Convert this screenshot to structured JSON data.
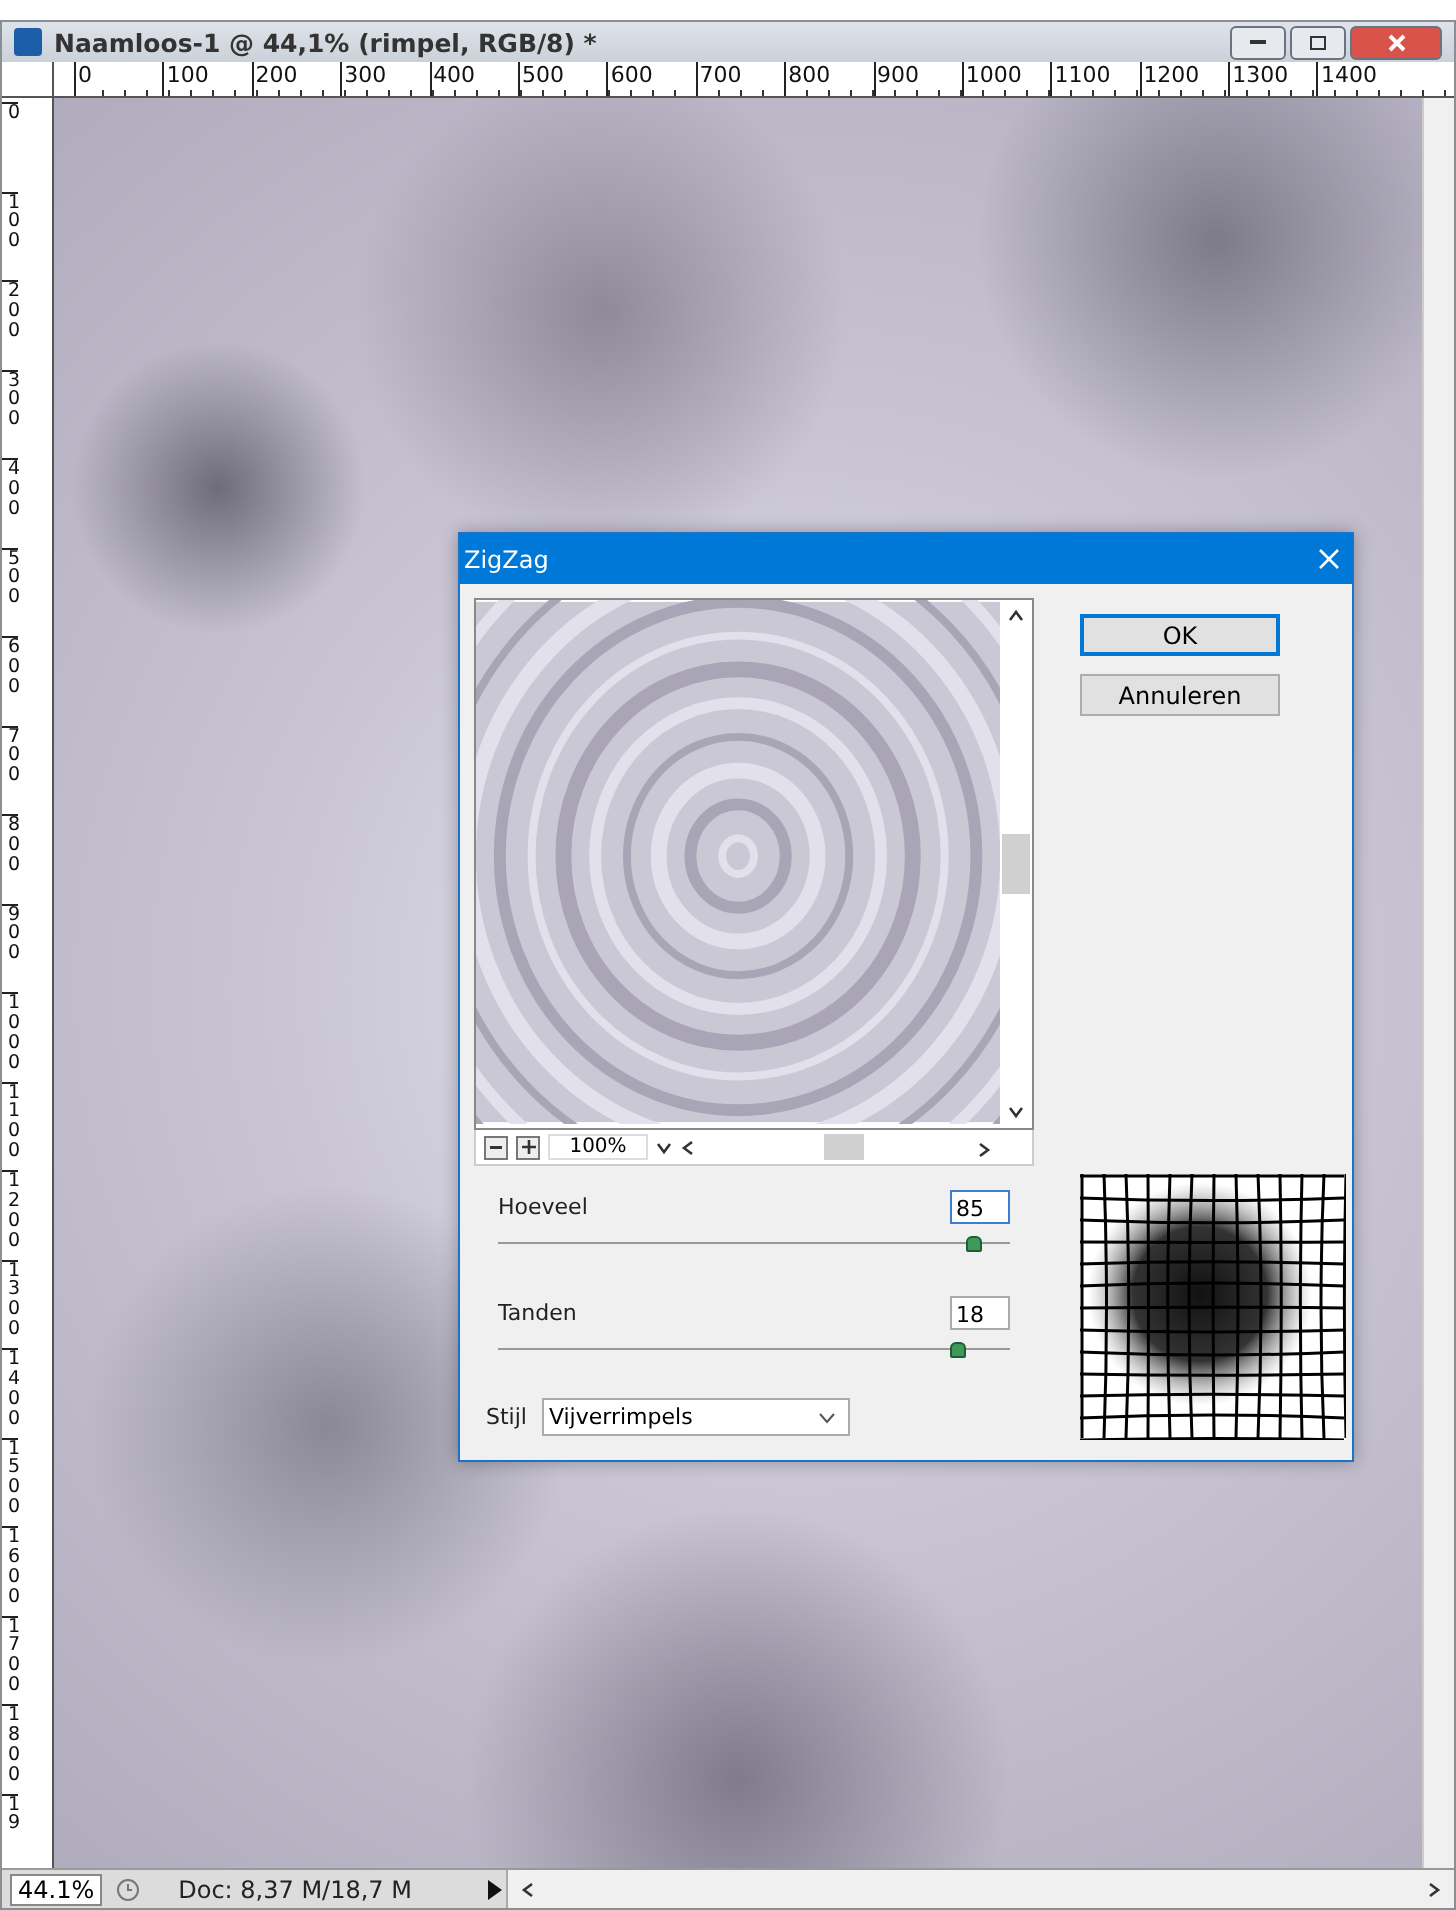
{
  "window": {
    "title": "Naamloos-1 @ 44,1% (rimpel, RGB/8) *"
  },
  "ruler_h": [
    "0",
    "100",
    "200",
    "300",
    "400",
    "500",
    "600",
    "700",
    "800",
    "900",
    "1000",
    "1100",
    "1200",
    "1300",
    "1400"
  ],
  "ruler_v": [
    "0",
    "100",
    "200",
    "300",
    "400",
    "500",
    "600",
    "700",
    "800",
    "900",
    "1000",
    "1100",
    "1200",
    "1300",
    "1400",
    "1500",
    "1600",
    "1700",
    "1800",
    "19"
  ],
  "dialog": {
    "title": "ZigZag",
    "buttons": [
      {
        "label": "OK",
        "selected": true
      },
      {
        "label": "Annuleren",
        "selected": false
      }
    ],
    "zoom": "100%",
    "sliders": [
      {
        "label": "Hoeveel",
        "value": "85",
        "level": 0.93,
        "focused": true
      },
      {
        "label": "Tanden",
        "value": "18",
        "level": 0.9,
        "focused": false
      }
    ],
    "style": {
      "label": "Stijl",
      "value": "Vijverrimpels"
    }
  },
  "status_bar": {
    "zoom": "44.1%",
    "doc": "Doc: 8,37 M/18,7 M"
  }
}
